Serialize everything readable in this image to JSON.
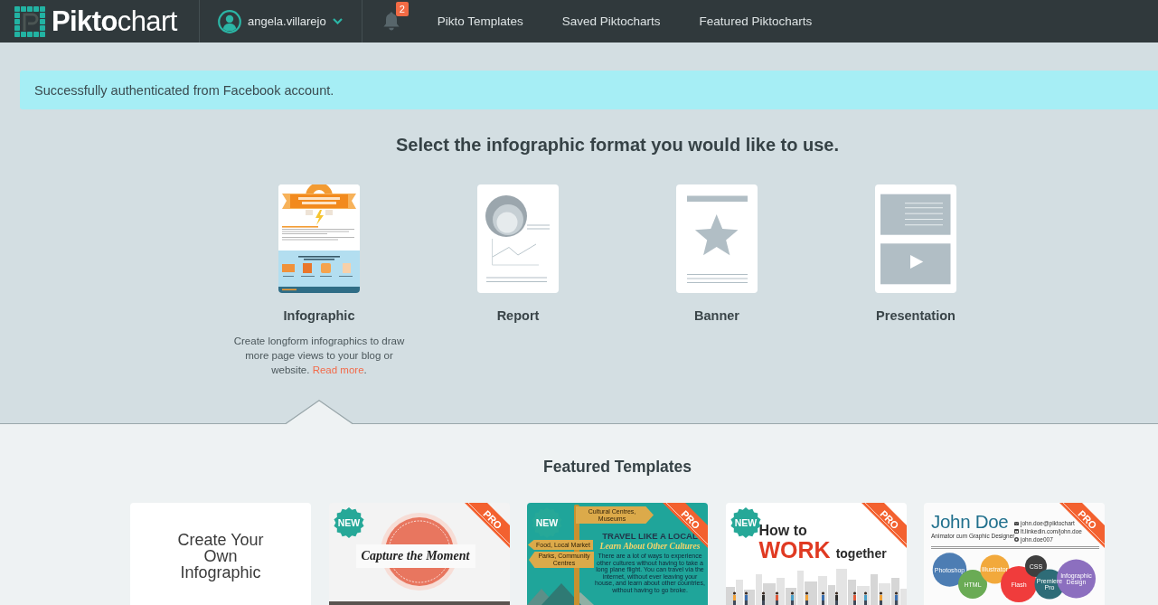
{
  "top_bar": {
    "logo": "**Pikto**chart",
    "user": "angela.villarejo",
    "notification_count": "2",
    "nav": [
      "Pikto Templates",
      "Saved Piktocharts",
      "Featured Piktocharts"
    ]
  },
  "alert": {
    "message": "Successfully authenticated from Facebook account."
  },
  "format_picker": {
    "title": "Select the infographic format you would like to use.",
    "formats": [
      {
        "kind": "infographic",
        "label": "Infographic",
        "selected": true,
        "description": "Create longform infographics to draw more page views to your blog or website.",
        "link": "Read more",
        "link_suffix": "."
      },
      {
        "kind": "report",
        "label": "Report",
        "selected": false
      },
      {
        "kind": "banner",
        "label": "Banner",
        "selected": false
      },
      {
        "kind": "presentation",
        "label": "Presentation",
        "selected": false
      }
    ]
  },
  "featured": {
    "title": "Featured Templates",
    "templates": [
      {
        "kind": "blank",
        "title": "Create Your Own Infographic"
      },
      {
        "kind": "capture",
        "badge": "NEW",
        "ribbon": "PRO",
        "title": "Capture the Moment"
      },
      {
        "kind": "travel",
        "badge": "NEW",
        "ribbon": "PRO",
        "signs": [
          {
            "kind": "right",
            "text": "Cultural Centres, Museums"
          },
          {
            "kind": "left",
            "text": "Food, Local Market"
          },
          {
            "kind": "left",
            "text": "Parks, Community Centres"
          }
        ],
        "title": "TRAVEL LIKE A LOCAL",
        "subtitle": "Learn About Other Cultures",
        "body": "There are a lot of ways to experience other cultures without having to take a long plane flight. You can travel via the internet, without ever leaving your house, and learn about other countries, without having to go broke."
      },
      {
        "kind": "work",
        "badge": "NEW",
        "ribbon": "PRO",
        "lines": [
          "How to",
          "WORK",
          "together"
        ]
      },
      {
        "kind": "resume",
        "ribbon": "PRO",
        "name": "John Doe",
        "role": "Animator cum Graphic Designer",
        "contacts": [
          {
            "kind": "email",
            "text": "john.doe@piktochart"
          },
          {
            "kind": "profile",
            "text": "lt.linkedin.com/john.doe"
          },
          {
            "kind": "chat",
            "text": "john.doe007"
          }
        ],
        "skills": [
          {
            "label": "Photoshop",
            "color": "#4d7db3"
          },
          {
            "label": "HTML",
            "color": "#6aab55"
          },
          {
            "label": "Illustrator",
            "color": "#f2a93c"
          },
          {
            "label": "Flash",
            "color": "#f03c3c"
          },
          {
            "label": "CSS",
            "color": "#3f3f3f"
          },
          {
            "label": "Premiere Pro",
            "color": "#2e6c77"
          },
          {
            "label": "Infographic Design",
            "color": "#8c6fbf"
          }
        ]
      }
    ]
  }
}
